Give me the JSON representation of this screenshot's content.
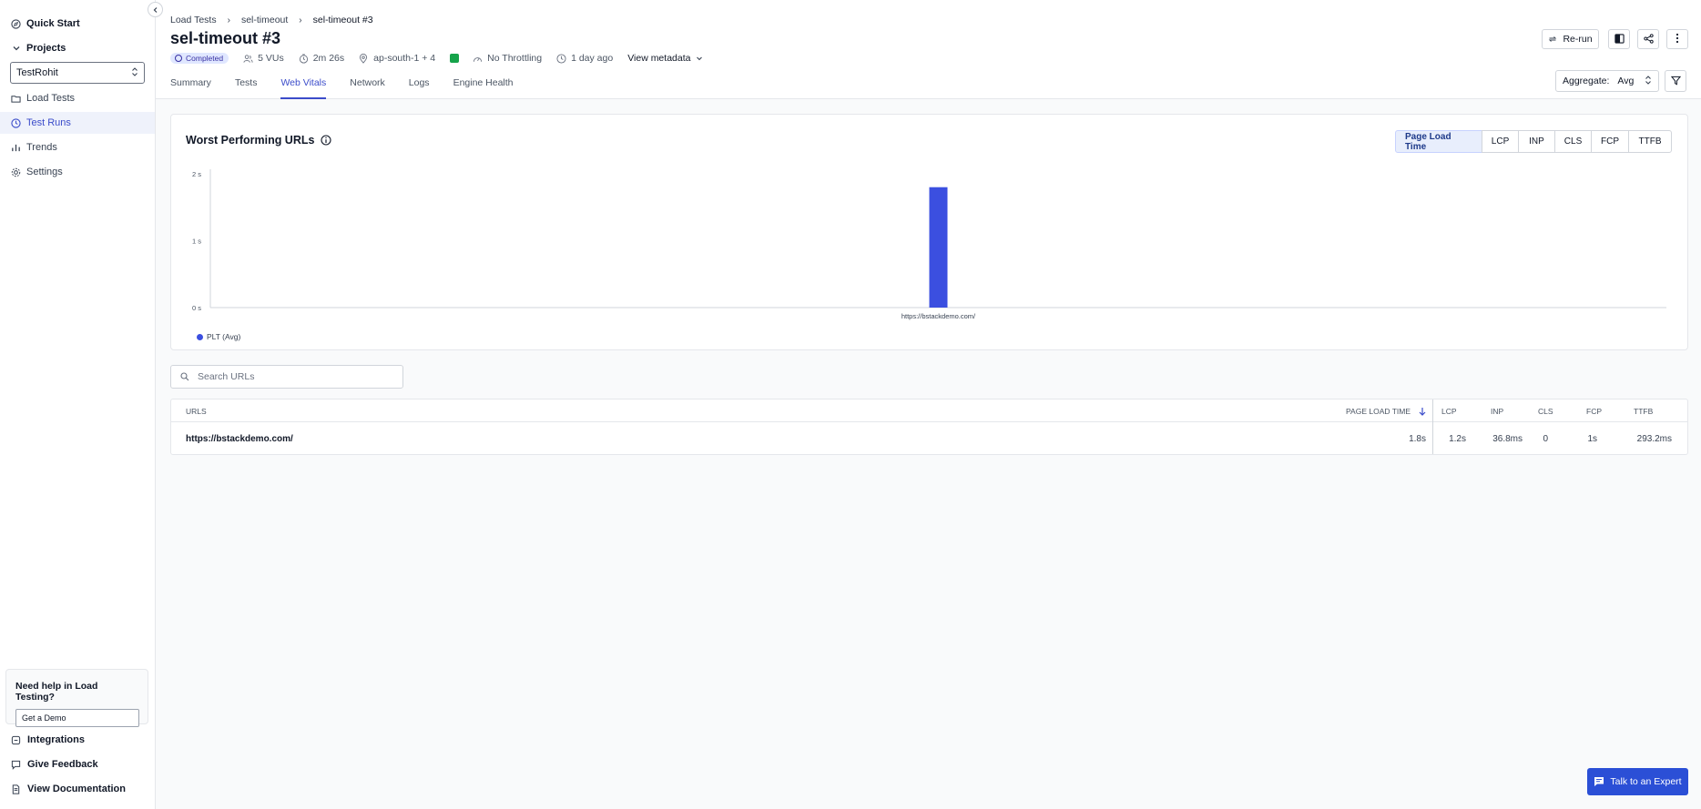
{
  "sidebar": {
    "quick_start": "Quick Start",
    "projects_label": "Projects",
    "project_selected": "TestRohit",
    "items": [
      {
        "label": "Load Tests",
        "icon": "folder-icon"
      },
      {
        "label": "Test Runs",
        "icon": "clock-icon"
      },
      {
        "label": "Trends",
        "icon": "bar-chart-icon"
      },
      {
        "label": "Settings",
        "icon": "gear-icon"
      }
    ],
    "help_title": "Need help in Load Testing?",
    "help_button": "Get a Demo",
    "bottom": [
      {
        "label": "Integrations",
        "icon": "plug-icon"
      },
      {
        "label": "Give Feedback",
        "icon": "feedback-icon"
      },
      {
        "label": "View Documentation",
        "icon": "document-icon"
      }
    ]
  },
  "header": {
    "breadcrumb": [
      "Load Tests",
      "sel-timeout",
      "sel-timeout #3"
    ],
    "title": "sel-timeout #3",
    "status": "Completed",
    "vus": "5 VUs",
    "duration": "2m 26s",
    "region": "ap-south-1 + 4",
    "throttling": "No Throttling",
    "time_ago": "1 day ago",
    "view_metadata": "View metadata",
    "tabs": [
      "Summary",
      "Tests",
      "Web Vitals",
      "Network",
      "Logs",
      "Engine Health"
    ],
    "active_tab": "Web Vitals",
    "rerun": "Re-run",
    "aggregate_label": "Aggregate:",
    "aggregate_value": "Avg"
  },
  "card": {
    "title": "Worst Performing URLs",
    "metrics": [
      "Page Load Time",
      "LCP",
      "INP",
      "CLS",
      "FCP",
      "TTFB"
    ],
    "active_metric": "Page Load Time"
  },
  "chart_data": {
    "type": "bar",
    "categories": [
      "https://bstackdemo.com/"
    ],
    "series": [
      {
        "name": "PLT (Avg)",
        "values": [
          1.8
        ]
      }
    ],
    "y_ticks": [
      "0 s",
      "1 s",
      "2 s"
    ],
    "ylim": [
      0,
      2
    ],
    "color": "#3b4fe0",
    "legend_position": "bottom-left"
  },
  "search": {
    "placeholder": "Search URLs"
  },
  "table": {
    "columns": [
      "URLS",
      "PAGE LOAD TIME",
      "LCP",
      "INP",
      "CLS",
      "FCP",
      "TTFB"
    ],
    "rows": [
      {
        "url": "https://bstackdemo.com/",
        "plt": "1.8s",
        "lcp": "1.2s",
        "inp": "36.8ms",
        "cls": "0",
        "fcp": "1s",
        "ttfb": "293.2ms"
      }
    ]
  },
  "expert_button": "Talk to an Expert",
  "colors": {
    "accent": "#3b4cca",
    "bar": "#3b4fe0",
    "status_green": "#16a34a"
  }
}
